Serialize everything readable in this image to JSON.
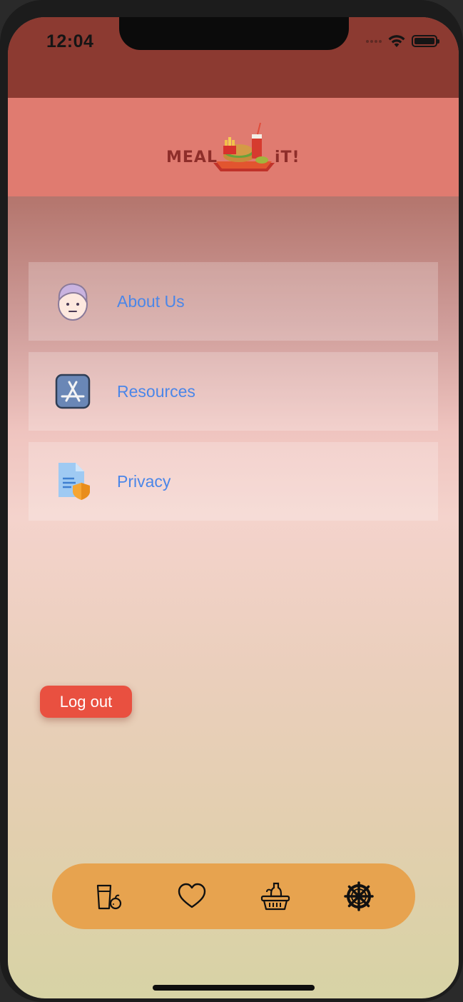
{
  "status_bar": {
    "time": "12:04"
  },
  "header": {
    "logo_left": "MEAL",
    "logo_right": "iT!"
  },
  "menu": {
    "items": [
      {
        "label": "About Us",
        "icon": "person-face-icon"
      },
      {
        "label": "Resources",
        "icon": "app-store-icon"
      },
      {
        "label": "Privacy",
        "icon": "privacy-document-shield-icon"
      }
    ]
  },
  "logout": {
    "label": "Log out"
  },
  "tabbar": {
    "tabs": [
      {
        "icon": "drink-food-icon"
      },
      {
        "icon": "heart-icon"
      },
      {
        "icon": "basket-icon"
      },
      {
        "icon": "settings-wheel-icon",
        "selected": true
      }
    ]
  },
  "colors": {
    "status_bar_bg": "#8c3a31",
    "header_bg": "#e07b70",
    "link_text": "#4b86e8",
    "logout_bg": "#e95040",
    "tabbar_bg": "#e7a34f"
  }
}
